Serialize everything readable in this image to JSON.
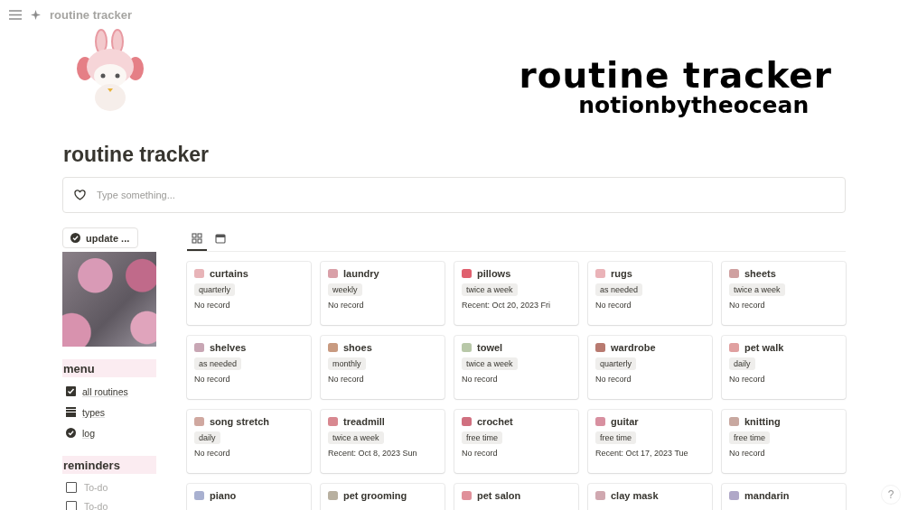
{
  "topbar": {
    "breadcrumb": "routine tracker"
  },
  "banner": {
    "title": "routine tracker",
    "subtitle": "notionbytheocean"
  },
  "page_title": "routine tracker",
  "callout": {
    "placeholder": "Type something..."
  },
  "sidebar": {
    "button": "update ...",
    "sections": [
      {
        "heading": "menu",
        "items": [
          {
            "kind": "checkbox",
            "label": "all routines"
          },
          {
            "kind": "stack",
            "label": "types"
          },
          {
            "kind": "check",
            "label": "log"
          }
        ]
      },
      {
        "heading": "reminders",
        "todos": [
          {
            "placeholder": "To-do",
            "checked": false
          },
          {
            "placeholder": "To-do",
            "checked": false
          }
        ]
      }
    ]
  },
  "views": [
    {
      "kind": "gallery",
      "selected": true
    },
    {
      "kind": "calendar",
      "selected": false
    }
  ],
  "cards": [
    {
      "name": "curtains",
      "color": "#e8b4b8",
      "tag": "quarterly",
      "recent": "No record"
    },
    {
      "name": "laundry",
      "color": "#d9a0a8",
      "tag": "weekly",
      "recent": "No record"
    },
    {
      "name": "pillows",
      "color": "#e0606e",
      "tag": "twice a week",
      "recent": "Recent: Oct 20, 2023 Fri"
    },
    {
      "name": "rugs",
      "color": "#eab3b8",
      "tag": "as needed",
      "recent": "No record"
    },
    {
      "name": "sheets",
      "color": "#cfa0a0",
      "tag": "twice a week",
      "recent": "No record"
    },
    {
      "name": "shelves",
      "color": "#c8a6b4",
      "tag": "as needed",
      "recent": "No record"
    },
    {
      "name": "shoes",
      "color": "#c89a80",
      "tag": "monthly",
      "recent": "No record"
    },
    {
      "name": "towel",
      "color": "#b8c8a8",
      "tag": "twice a week",
      "recent": "No record"
    },
    {
      "name": "wardrobe",
      "color": "#b87a70",
      "tag": "quarterly",
      "recent": "No record"
    },
    {
      "name": "pet walk",
      "color": "#e0a0a0",
      "tag": "daily",
      "recent": "No record"
    },
    {
      "name": "song stretch",
      "color": "#d0a8a0",
      "tag": "daily",
      "recent": "No record"
    },
    {
      "name": "treadmill",
      "color": "#d88890",
      "tag": "twice a week",
      "recent": "Recent: Oct 8, 2023 Sun"
    },
    {
      "name": "crochet",
      "color": "#d07080",
      "tag": "free time",
      "recent": "No record"
    },
    {
      "name": "guitar",
      "color": "#d890a0",
      "tag": "free time",
      "recent": "Recent: Oct 17, 2023 Tue"
    },
    {
      "name": "knitting",
      "color": "#c8a8a0",
      "tag": "free time",
      "recent": "No record"
    },
    {
      "name": "piano",
      "color": "#a8b0d0"
    },
    {
      "name": "pet grooming",
      "color": "#b8b0a0"
    },
    {
      "name": "pet salon",
      "color": "#e0909a"
    },
    {
      "name": "clay mask",
      "color": "#d0a8b0"
    },
    {
      "name": "mandarin",
      "color": "#b0a8c8"
    }
  ],
  "help": "?"
}
